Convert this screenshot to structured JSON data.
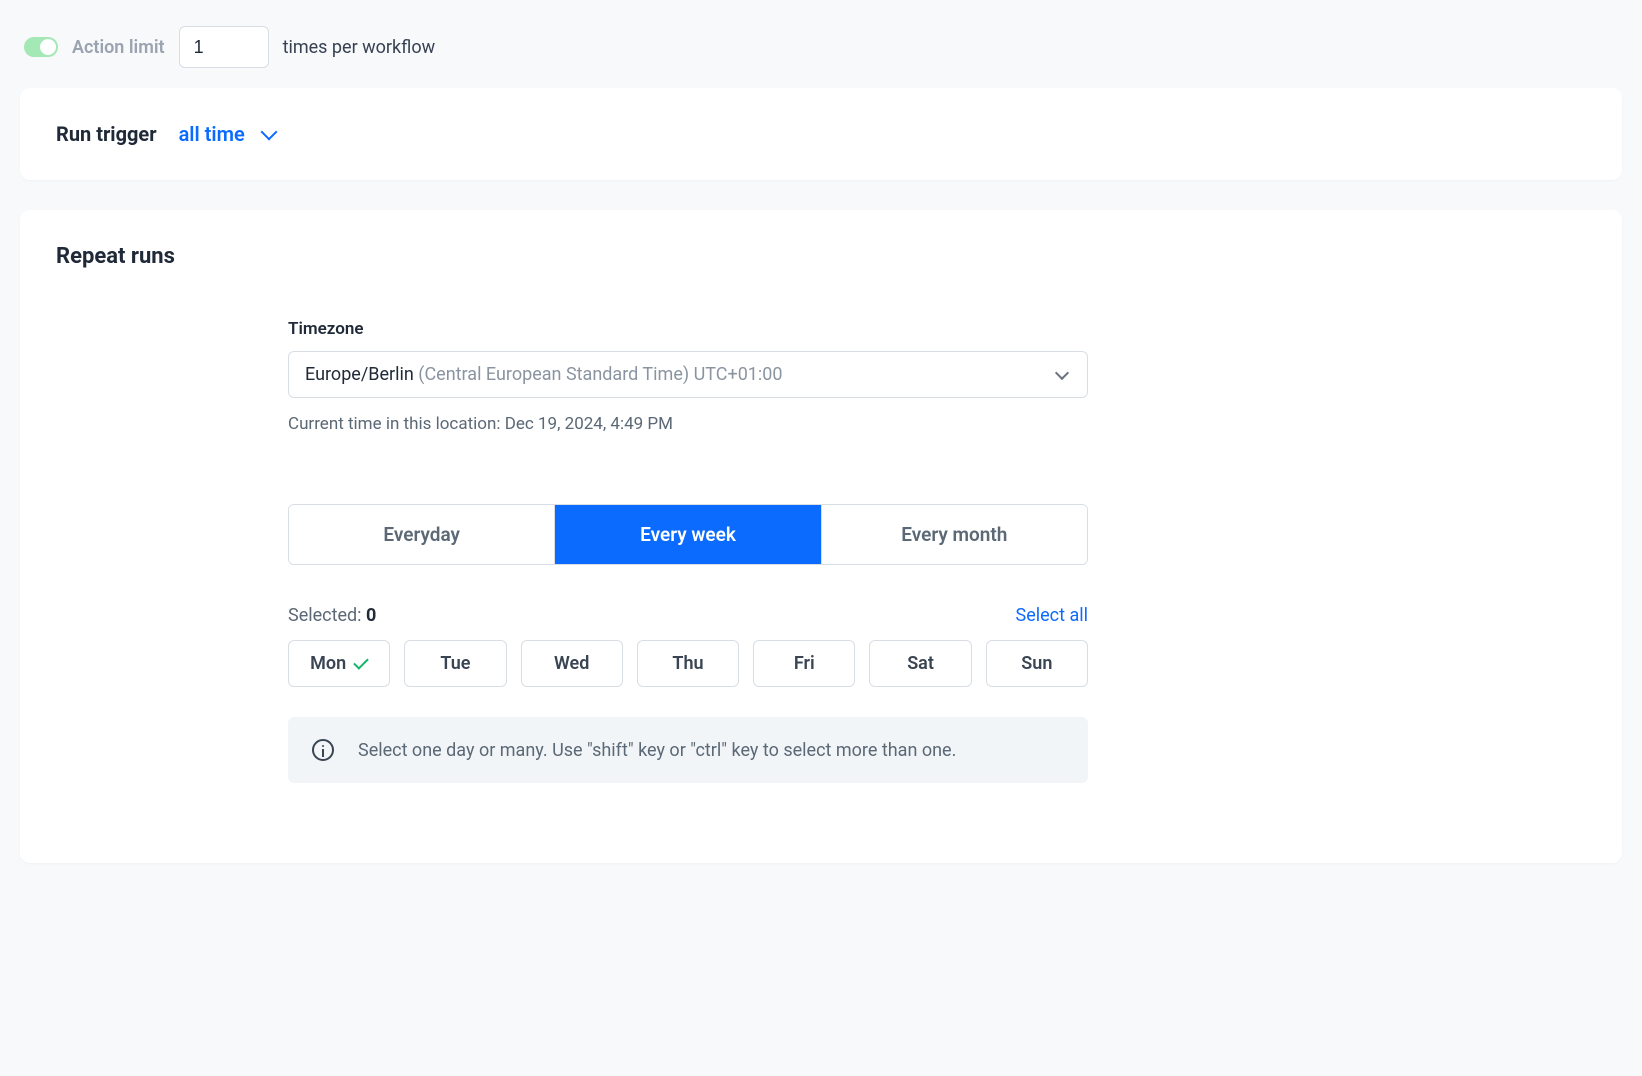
{
  "actionLimit": {
    "label": "Action limit",
    "value": "1",
    "suffix": "times per workflow",
    "enabled": true
  },
  "runTrigger": {
    "label": "Run trigger",
    "value": "all time"
  },
  "repeatRuns": {
    "title": "Repeat runs",
    "timezone": {
      "label": "Timezone",
      "primary": "Europe/Berlin",
      "secondary": " (Central European Standard Time) UTC+01:00",
      "currentTime": "Current time in this location: Dec 19, 2024, 4:49 PM"
    },
    "frequency": {
      "options": [
        "Everyday",
        "Every week",
        "Every month"
      ],
      "active": "Every week"
    },
    "selection": {
      "selectedLabel": "Selected: ",
      "selectedCount": "0",
      "selectAll": "Select all"
    },
    "days": [
      {
        "label": "Mon",
        "checked": true
      },
      {
        "label": "Tue",
        "checked": false
      },
      {
        "label": "Wed",
        "checked": false
      },
      {
        "label": "Thu",
        "checked": false
      },
      {
        "label": "Fri",
        "checked": false
      },
      {
        "label": "Sat",
        "checked": false
      },
      {
        "label": "Sun",
        "checked": false
      }
    ],
    "info": "Select one day or many. Use \"shift\" key or \"ctrl\" key to select more than one."
  }
}
